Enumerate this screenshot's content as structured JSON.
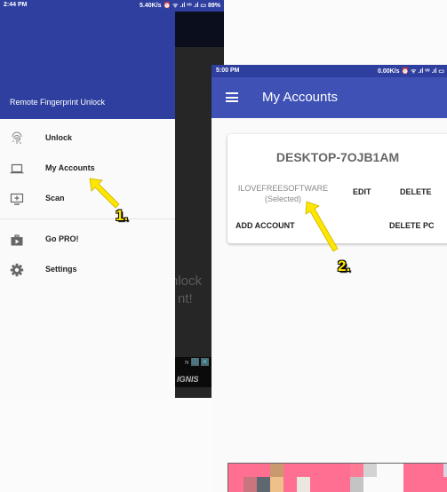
{
  "left_screen": {
    "status_bar": {
      "time": "2:44 PM",
      "right": "5.40K/s ⏰ ᯤ .ıl ᵛᵒ .ıl ▭ 89%"
    },
    "drawer": {
      "title": "Remote Fingerprint Unlock",
      "items": [
        {
          "label": "Unlock",
          "icon": "fingerprint-icon"
        },
        {
          "label": "My Accounts",
          "icon": "laptop-icon"
        },
        {
          "label": "Scan",
          "icon": "add-to-screen-icon"
        },
        {
          "label": "Go PRO!",
          "icon": "shop-icon"
        },
        {
          "label": "Settings",
          "icon": "gear-icon"
        }
      ]
    },
    "background_text": [
      "nlock",
      "nt!"
    ],
    "ad": {
      "brand": "IGNIS",
      "n": "N",
      "info": "ⓘ",
      "close": "✕"
    },
    "annotation": "1."
  },
  "right_screen": {
    "status_bar": {
      "time": "5:00 PM",
      "right": "0.00K/s ⏰ ᯤ .ıl ᵛᵒ .ıl ▭"
    },
    "toolbar": {
      "title": "My Accounts",
      "menu_icon": "hamburger-icon"
    },
    "card": {
      "pc_name": "DESKTOP-7OJB1AM",
      "account_name": "ILOVEFREESOFTWARE",
      "account_status": "(Selected)",
      "edit_label": "EDIT",
      "delete_label": "DELETE",
      "add_account_label": "ADD ACCOUNT",
      "delete_pc_label": "DELETE PC"
    },
    "annotation": "2."
  },
  "colors": {
    "primary_dark": "#2f3f9f",
    "primary": "#3f51b5",
    "arrow": "#ffe600"
  }
}
